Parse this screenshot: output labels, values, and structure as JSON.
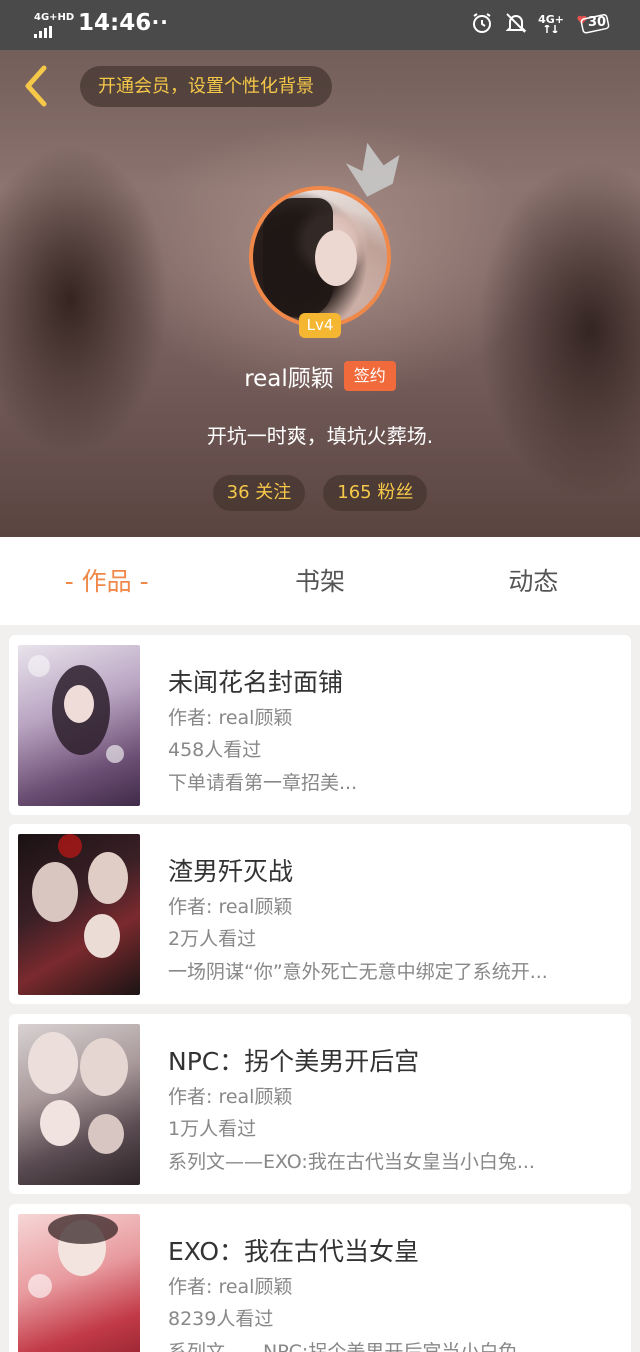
{
  "status_bar": {
    "network_tag": "4G+HD",
    "time": "14:46",
    "dots": "···",
    "network_right": "4G+",
    "battery": "30"
  },
  "header": {
    "vip_prompt": "开通会员，设置个性化背景",
    "level": "Lv4",
    "username": "real顾颖",
    "signed_badge": "签约",
    "bio": "开坑一时爽，填坑火葬场.",
    "following": "36 关注",
    "followers": "165 粉丝"
  },
  "tabs": [
    {
      "label": "- 作品 -",
      "active": true
    },
    {
      "label": "书架",
      "active": false
    },
    {
      "label": "动态",
      "active": false
    }
  ],
  "books": [
    {
      "title": "未闻花名封面铺",
      "author": "作者: real顾颖",
      "views": "458人看过",
      "desc": "下单请看第一章招美..."
    },
    {
      "title": "渣男歼灭战",
      "author": "作者: real顾颖",
      "views": "2万人看过",
      "desc": "一场阴谋“你”意外死亡无意中绑定了系统开..."
    },
    {
      "title": "NPC：拐个美男开后宫",
      "author": "作者: real顾颖",
      "views": "1万人看过",
      "desc": "系列文——EXO:我在古代当女皇当小白兔..."
    },
    {
      "title": "EXO：我在古代当女皇",
      "author": "作者: real顾颖",
      "views": "8239人看过",
      "desc": "系列文——NPC:拐个美男开后宫当小白兔..."
    }
  ],
  "colors": {
    "accent": "#f0884a",
    "gold": "#f5c84a",
    "signed": "#f06a3b",
    "level": "#f5b731"
  }
}
